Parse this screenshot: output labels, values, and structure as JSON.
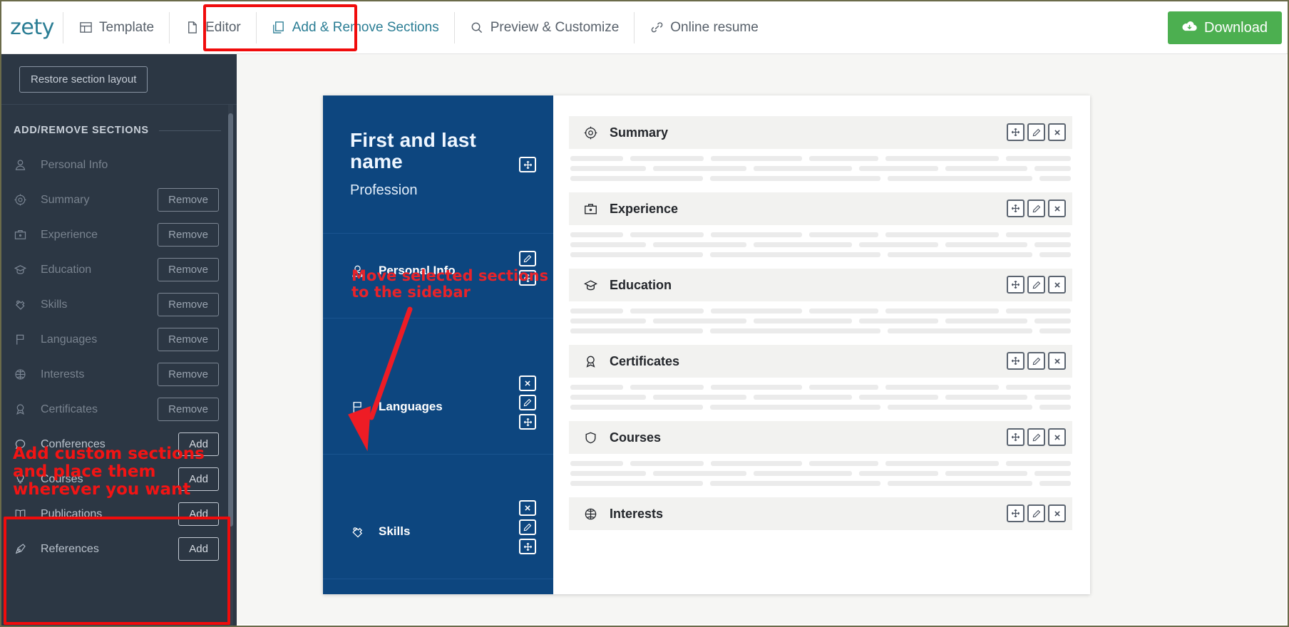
{
  "app": {
    "logo": "zety"
  },
  "topnav": {
    "items": [
      {
        "label": "Template",
        "icon": "template-icon",
        "active": false
      },
      {
        "label": "Editor",
        "icon": "document-icon",
        "active": false
      },
      {
        "label": "Add & Remove Sections",
        "icon": "copy-icon",
        "active": true
      },
      {
        "label": "Preview & Customize",
        "icon": "search-icon",
        "active": false
      },
      {
        "label": "Online resume",
        "icon": "link-icon",
        "active": false
      }
    ],
    "download_label": "Download",
    "download_color": "#4caf50",
    "highlight_color": "#f00c0c"
  },
  "left_panel": {
    "restore_label": "Restore section layout",
    "heading": "ADD/REMOVE SECTIONS",
    "annotation": "Add custom sections\nand place them\nwherever you want",
    "annotation_color": "#f21414",
    "rows": [
      {
        "label": "Personal Info",
        "icon": "person-icon",
        "action": ""
      },
      {
        "label": "Summary",
        "icon": "target-icon",
        "action": "Remove"
      },
      {
        "label": "Experience",
        "icon": "briefcase-icon",
        "action": "Remove"
      },
      {
        "label": "Education",
        "icon": "graduation-cap-icon",
        "action": "Remove"
      },
      {
        "label": "Skills",
        "icon": "puzzle-icon",
        "action": "Remove"
      },
      {
        "label": "Languages",
        "icon": "flag-icon",
        "action": "Remove"
      },
      {
        "label": "Interests",
        "icon": "basketball-icon",
        "action": "Remove"
      },
      {
        "label": "Certificates",
        "icon": "award-icon",
        "action": "Remove"
      },
      {
        "label": "Conferences",
        "icon": "speech-bubble-icon",
        "action": "Add"
      },
      {
        "label": "Courses",
        "icon": "lightbulb-icon",
        "action": "Add"
      },
      {
        "label": "Publications",
        "icon": "book-icon",
        "action": "Add"
      },
      {
        "label": "References",
        "icon": "pen-icon",
        "action": "Add"
      }
    ]
  },
  "resume": {
    "sidebar": {
      "background": "#0d467f",
      "name": "First and last name",
      "profession": "Profession",
      "annotation": "Move selected sections\nto the sidebar",
      "annotation_color": "#e8232a",
      "rows": [
        {
          "label": "Personal Info",
          "icon": "person-icon",
          "controls": [
            "edit-icon",
            "move-icon"
          ]
        },
        {
          "label": "Languages",
          "icon": "flag-icon",
          "controls": [
            "close-icon",
            "edit-icon",
            "move-icon"
          ]
        },
        {
          "label": "Skills",
          "icon": "puzzle-icon",
          "controls": [
            "close-icon",
            "edit-icon",
            "move-icon"
          ]
        }
      ],
      "header_controls": [
        "move-icon"
      ]
    },
    "main_sections": [
      {
        "label": "Summary",
        "icon": "target-icon",
        "controls": [
          "move-icon",
          "edit-icon",
          "close-icon"
        ]
      },
      {
        "label": "Experience",
        "icon": "briefcase-icon",
        "controls": [
          "move-icon",
          "edit-icon",
          "close-icon"
        ]
      },
      {
        "label": "Education",
        "icon": "graduation-cap-icon",
        "controls": [
          "move-icon",
          "edit-icon",
          "close-icon"
        ]
      },
      {
        "label": "Certificates",
        "icon": "award-icon",
        "controls": [
          "move-icon",
          "edit-icon",
          "close-icon"
        ]
      },
      {
        "label": "Courses",
        "icon": "shield-icon",
        "controls": [
          "move-icon",
          "edit-icon",
          "close-icon"
        ]
      },
      {
        "label": "Interests",
        "icon": "basketball-icon",
        "controls": [
          "move-icon",
          "edit-icon",
          "close-icon"
        ]
      }
    ]
  }
}
